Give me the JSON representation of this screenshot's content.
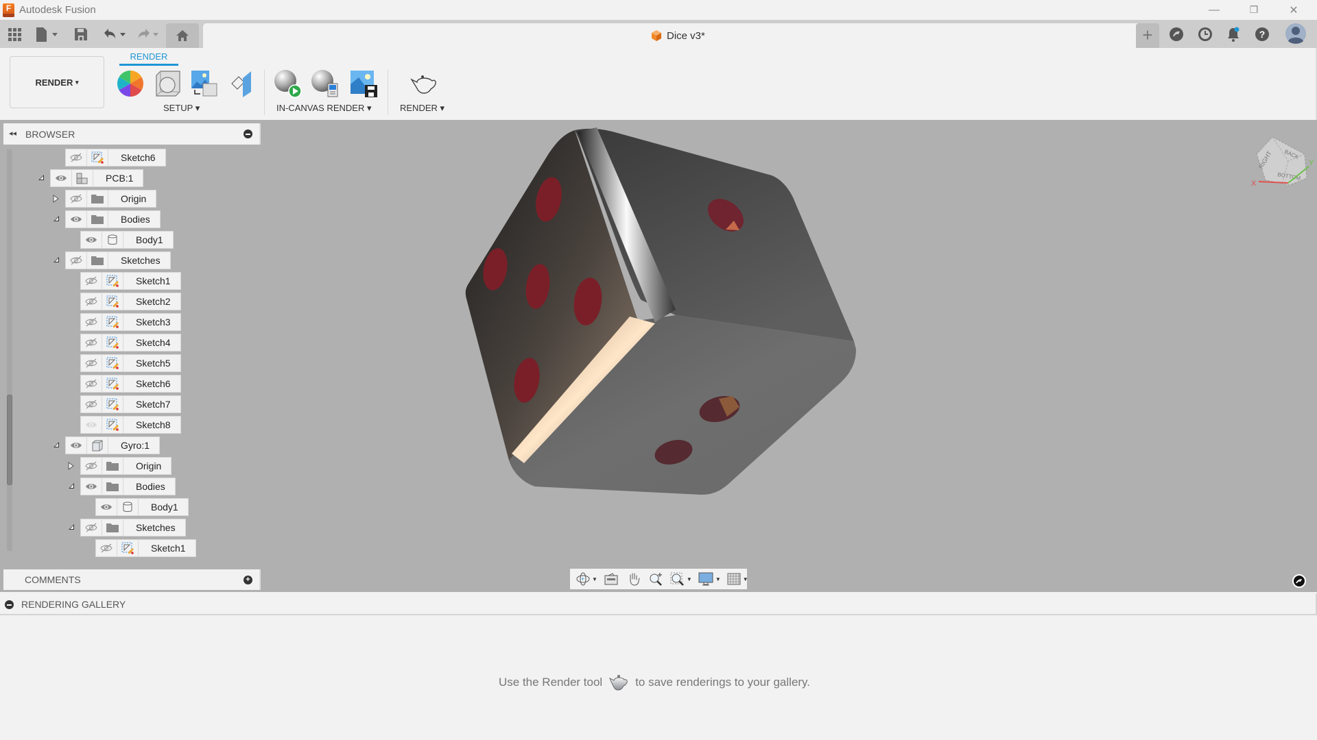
{
  "window": {
    "app_title": "Autodesk Fusion",
    "logo_letter": "F",
    "controls": {
      "minimize": "—",
      "restore": "❐",
      "close": "✕"
    }
  },
  "tabbar": {
    "quick_access": [
      "grid-menu-icon",
      "file-icon",
      "save-icon",
      "undo-icon",
      "redo-icon",
      "home-icon"
    ],
    "document_tab": {
      "label": "Dice v3*",
      "close": "✕"
    },
    "right_icons": [
      "add-tab-icon",
      "extensions-icon",
      "job-status-icon",
      "notifications-icon",
      "help-icon",
      "profile-avatar"
    ],
    "notification_dot_color": "#1e96d6"
  },
  "ribbon": {
    "workspace_label": "RENDER",
    "workspace_caret": "▾",
    "active_tab": "RENDER",
    "accent_color": "#1e96d6",
    "groups": [
      {
        "label": "SETUP ▾",
        "tools": [
          "appearance-icon",
          "scene-settings-icon",
          "texture-map-icon",
          "decal-icon"
        ]
      },
      {
        "label": "IN-CANVAS RENDER ▾",
        "tools": [
          "in-canvas-render-icon",
          "in-canvas-render-settings-icon",
          "capture-image-icon"
        ]
      },
      {
        "label": "RENDER ▾",
        "tools": [
          "render-teapot-icon"
        ]
      }
    ]
  },
  "browser": {
    "title": "BROWSER",
    "items": [
      {
        "label": "Sketch6",
        "level": 2,
        "toggle": "none",
        "visible": false,
        "type": "sketch"
      },
      {
        "label": "PCB:1",
        "level": 1,
        "toggle": "expanded",
        "visible": true,
        "type": "component"
      },
      {
        "label": "Origin",
        "level": 2,
        "toggle": "collapsed",
        "visible": false,
        "type": "folder"
      },
      {
        "label": "Bodies",
        "level": 2,
        "toggle": "expanded",
        "visible": true,
        "type": "folder"
      },
      {
        "label": "Body1",
        "level": 3,
        "toggle": "none",
        "visible": true,
        "type": "body"
      },
      {
        "label": "Sketches",
        "level": 2,
        "toggle": "expanded",
        "visible": false,
        "type": "folder"
      },
      {
        "label": "Sketch1",
        "level": 3,
        "toggle": "none",
        "visible": false,
        "type": "sketch"
      },
      {
        "label": "Sketch2",
        "level": 3,
        "toggle": "none",
        "visible": false,
        "type": "sketch"
      },
      {
        "label": "Sketch3",
        "level": 3,
        "toggle": "none",
        "visible": false,
        "type": "sketch"
      },
      {
        "label": "Sketch4",
        "level": 3,
        "toggle": "none",
        "visible": false,
        "type": "sketch"
      },
      {
        "label": "Sketch5",
        "level": 3,
        "toggle": "none",
        "visible": false,
        "type": "sketch"
      },
      {
        "label": "Sketch6",
        "level": 3,
        "toggle": "none",
        "visible": false,
        "type": "sketch"
      },
      {
        "label": "Sketch7",
        "level": 3,
        "toggle": "none",
        "visible": false,
        "type": "sketch"
      },
      {
        "label": "Sketch8",
        "level": 3,
        "toggle": "none",
        "visible": "faded",
        "type": "sketch"
      },
      {
        "label": "Gyro:1",
        "level": 2,
        "toggle": "expanded",
        "visible": true,
        "type": "component-box"
      },
      {
        "label": "Origin",
        "level": 3,
        "toggle": "collapsed",
        "visible": false,
        "type": "folder"
      },
      {
        "label": "Bodies",
        "level": 3,
        "toggle": "expanded",
        "visible": true,
        "type": "folder"
      },
      {
        "label": "Body1",
        "level": 4,
        "toggle": "none",
        "visible": true,
        "type": "body"
      },
      {
        "label": "Sketches",
        "level": 3,
        "toggle": "expanded",
        "visible": false,
        "type": "folder"
      },
      {
        "label": "Sketch1",
        "level": 4,
        "toggle": "none",
        "visible": false,
        "type": "sketch"
      }
    ]
  },
  "comments": {
    "title": "COMMENTS"
  },
  "navbar": {
    "tools": [
      {
        "icon": "orbit-icon",
        "caret": true
      },
      {
        "icon": "look-at-icon",
        "caret": false
      },
      {
        "icon": "pan-icon",
        "caret": false
      },
      {
        "icon": "zoom-icon",
        "caret": false
      },
      {
        "icon": "zoom-window-icon",
        "caret": true
      },
      {
        "icon": "display-settings-icon",
        "caret": true
      },
      {
        "icon": "grid-settings-icon",
        "caret": true
      }
    ]
  },
  "viewcube": {
    "faces": [
      "RIGHT",
      "BACK",
      "BOTTOM"
    ],
    "axes": {
      "x": "X",
      "y": "Y"
    },
    "x_color": "#e05050",
    "y_color": "#6cc04a"
  },
  "model": {
    "name": "Dice",
    "body_color": "#555555",
    "pip_color": "#7a1f28",
    "visible_faces": [
      {
        "face": "left",
        "pips": 5
      },
      {
        "face": "top",
        "pips": 1
      },
      {
        "face": "front",
        "pips": 2
      }
    ]
  },
  "gallery": {
    "title": "RENDERING GALLERY",
    "message_before": "Use the Render tool",
    "message_after": "to save renderings to your gallery."
  }
}
